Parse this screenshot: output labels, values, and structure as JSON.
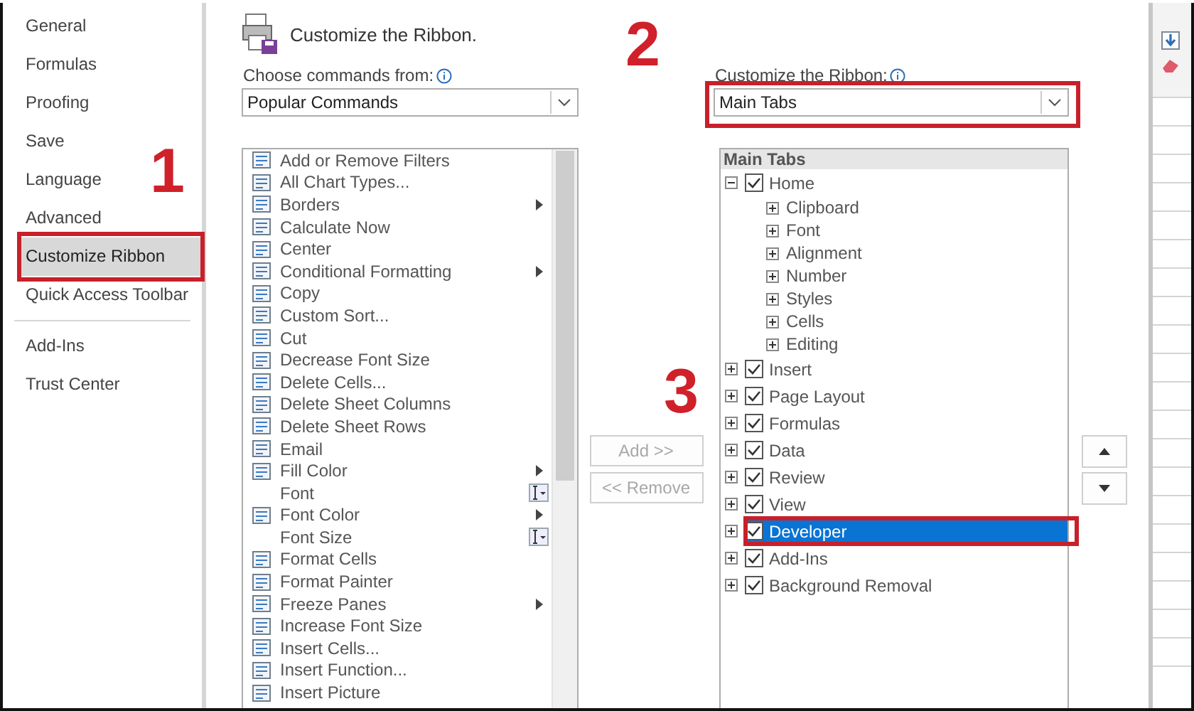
{
  "sidebar": {
    "groups": [
      {
        "items": [
          {
            "label": "General",
            "selected": false,
            "highlighted": false
          },
          {
            "label": "Formulas",
            "selected": false,
            "highlighted": false
          },
          {
            "label": "Proofing",
            "selected": false,
            "highlighted": false
          },
          {
            "label": "Save",
            "selected": false,
            "highlighted": false
          },
          {
            "label": "Language",
            "selected": false,
            "highlighted": false
          },
          {
            "label": "Advanced",
            "selected": false,
            "highlighted": false
          },
          {
            "label": "Customize Ribbon",
            "selected": true,
            "highlighted": true,
            "step": "1"
          },
          {
            "label": "Quick Access Toolbar",
            "selected": false,
            "highlighted": false
          }
        ]
      },
      {
        "items": [
          {
            "label": "Add-Ins",
            "selected": false,
            "highlighted": false
          },
          {
            "label": "Trust Center",
            "selected": false,
            "highlighted": false
          }
        ]
      }
    ]
  },
  "header": {
    "title": "Customize the Ribbon."
  },
  "commands": {
    "label": "Choose commands from:",
    "dropdown": {
      "value": "Popular Commands"
    },
    "items": [
      {
        "label": "Add or Remove Filters",
        "kind": "plain"
      },
      {
        "label": "All Chart Types...",
        "kind": "plain"
      },
      {
        "label": "Borders",
        "kind": "submenu"
      },
      {
        "label": "Calculate Now",
        "kind": "plain"
      },
      {
        "label": "Center",
        "kind": "plain"
      },
      {
        "label": "Conditional Formatting",
        "kind": "submenu"
      },
      {
        "label": "Copy",
        "kind": "plain"
      },
      {
        "label": "Custom Sort...",
        "kind": "plain"
      },
      {
        "label": "Cut",
        "kind": "plain"
      },
      {
        "label": "Decrease Font Size",
        "kind": "plain"
      },
      {
        "label": "Delete Cells...",
        "kind": "plain"
      },
      {
        "label": "Delete Sheet Columns",
        "kind": "plain"
      },
      {
        "label": "Delete Sheet Rows",
        "kind": "plain"
      },
      {
        "label": "Email",
        "kind": "plain"
      },
      {
        "label": "Fill Color",
        "kind": "submenu"
      },
      {
        "label": "Font",
        "kind": "field"
      },
      {
        "label": "Font Color",
        "kind": "submenu"
      },
      {
        "label": "Font Size",
        "kind": "field"
      },
      {
        "label": "Format Cells",
        "kind": "plain"
      },
      {
        "label": "Format Painter",
        "kind": "plain"
      },
      {
        "label": "Freeze Panes",
        "kind": "submenu"
      },
      {
        "label": "Increase Font Size",
        "kind": "plain"
      },
      {
        "label": "Insert Cells...",
        "kind": "plain"
      },
      {
        "label": "Insert Function...",
        "kind": "plain"
      },
      {
        "label": "Insert Picture",
        "kind": "plain"
      }
    ]
  },
  "buttons": [
    {
      "label": "Add >>",
      "disabled": true
    },
    {
      "label": "<< Remove",
      "disabled": true
    }
  ],
  "ribbon": {
    "label": "Customize the Ribbon:",
    "dropdown": {
      "value": "Main Tabs",
      "highlighted": true,
      "step": "2"
    },
    "tree": {
      "header": "Main Tabs",
      "nodes": [
        {
          "label": "Home",
          "checked": true,
          "expanded": true,
          "selected": false,
          "highlighted": false,
          "children": [
            {
              "label": "Clipboard",
              "expanded": false,
              "selected": false
            },
            {
              "label": "Font",
              "expanded": false,
              "selected": false
            },
            {
              "label": "Alignment",
              "expanded": false,
              "selected": false
            },
            {
              "label": "Number",
              "expanded": false,
              "selected": false
            },
            {
              "label": "Styles",
              "expanded": false,
              "selected": false
            },
            {
              "label": "Cells",
              "expanded": false,
              "selected": false
            },
            {
              "label": "Editing",
              "expanded": false,
              "selected": false
            }
          ]
        },
        {
          "label": "Insert",
          "checked": true,
          "expanded": false,
          "selected": false,
          "highlighted": false
        },
        {
          "label": "Page Layout",
          "checked": true,
          "expanded": false,
          "selected": false,
          "highlighted": false
        },
        {
          "label": "Formulas",
          "checked": true,
          "expanded": false,
          "selected": false,
          "highlighted": false
        },
        {
          "label": "Data",
          "checked": true,
          "expanded": false,
          "selected": false,
          "highlighted": false
        },
        {
          "label": "Review",
          "checked": true,
          "expanded": false,
          "selected": false,
          "highlighted": false
        },
        {
          "label": "View",
          "checked": true,
          "expanded": false,
          "selected": false,
          "highlighted": false
        },
        {
          "label": "Developer",
          "checked": true,
          "expanded": false,
          "selected": true,
          "highlighted": true,
          "step": "3"
        },
        {
          "label": "Add-Ins",
          "checked": true,
          "expanded": false,
          "selected": false,
          "highlighted": false
        },
        {
          "label": "Background Removal",
          "checked": true,
          "expanded": false,
          "selected": false,
          "highlighted": false
        }
      ]
    }
  }
}
